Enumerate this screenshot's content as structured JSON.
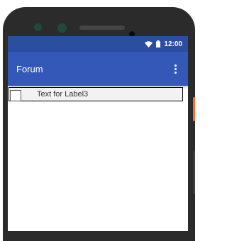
{
  "status_bar": {
    "time": "12:00",
    "wifi_icon": "wifi-icon",
    "battery_icon": "battery-icon"
  },
  "app_bar": {
    "title": "Forum",
    "overflow_icon": "more-vert-icon"
  },
  "list": {
    "items": [
      {
        "label": "Text for Label3",
        "checked": false
      }
    ]
  },
  "colors": {
    "status_bar": "#2c4ea0",
    "app_bar": "#3358b8",
    "phone_body": "#2b2b2b"
  }
}
